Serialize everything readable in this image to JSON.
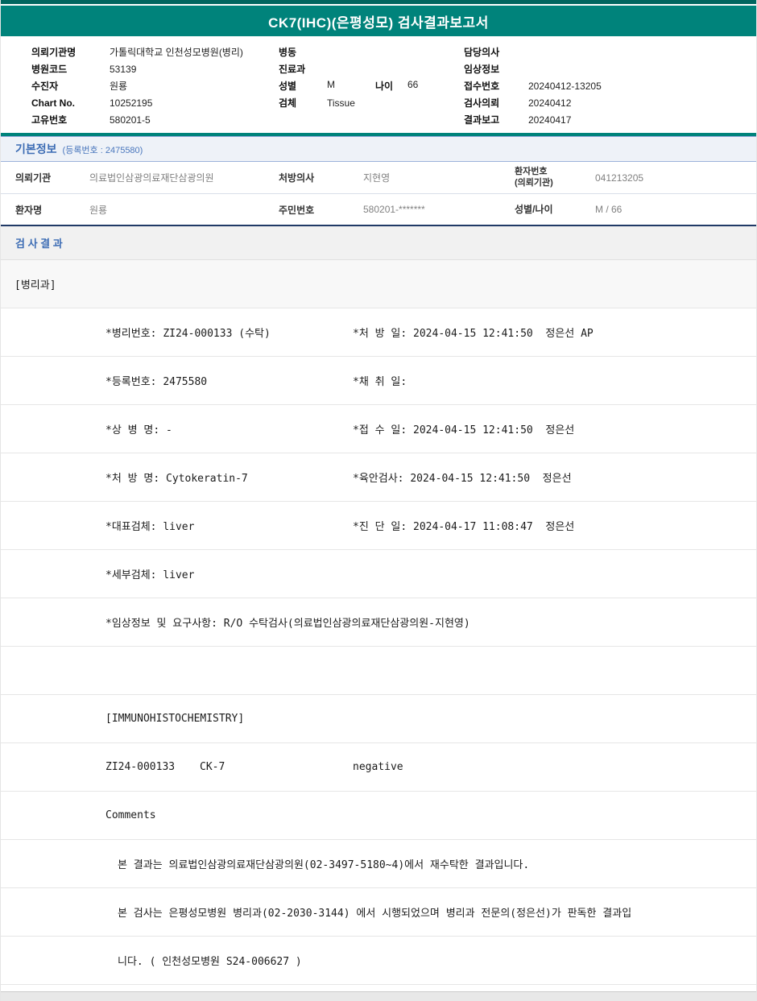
{
  "header": {
    "title": "CK7(IHC)(은평성모) 검사결과보고서"
  },
  "patient_info": {
    "rows": [
      {
        "l_label": "의뢰기관명",
        "l_value": "가톨릭대학교 인천성모병원(병리)",
        "m_label": "병동",
        "m_value": "",
        "r_label": "담당의사",
        "r_value": ""
      },
      {
        "l_label": "병원코드",
        "l_value": "53139",
        "m_label": "진료과",
        "m_value": "",
        "r_label": "임상정보",
        "r_value": ""
      },
      {
        "l_label": "수진자",
        "l_value": "원룡",
        "m_label": "성별",
        "m_value": "M",
        "m_label2": "나이",
        "m_value2": "66",
        "r_label": "접수번호",
        "r_value": "20240412-13205"
      },
      {
        "l_label": "Chart No.",
        "l_value": "10252195",
        "m_label": "검체",
        "m_value": "Tissue",
        "r_label": "검사의뢰",
        "r_value": "20240412"
      },
      {
        "l_label": "고유번호",
        "l_value": "580201-5",
        "m_label": "",
        "m_value": "",
        "r_label": "결과보고",
        "r_value": "20240417"
      }
    ]
  },
  "basic_info": {
    "title": "기본정보",
    "subtitle": "(등록번호 : 2475580)",
    "row1": {
      "c1": "의뢰기관",
      "c2": "의료법인삼광의료재단삼광의원",
      "c3": "처방의사",
      "c4": "지현영",
      "c5a": "환자번호",
      "c5b": "(의뢰기관)",
      "c6": "041213205"
    },
    "row2": {
      "c1": "환자명",
      "c2": "원룡",
      "c3": "주민번호",
      "c4": "580201-*******",
      "c5a": "성별/나이",
      "c5b": "",
      "c6": "M / 66"
    }
  },
  "results": {
    "title": "검 사 결 과",
    "department": "[병리과]",
    "detail_rows": [
      {
        "left": "*병리번호: ZI24-000133 (수탁)",
        "right": "*처 방 일: 2024-04-15 12:41:50  정은선 AP"
      },
      {
        "left": "*등록번호: 2475580",
        "right": "*채 취 일:"
      },
      {
        "left": "*상 병 명: -",
        "right": "*접 수 일: 2024-04-15 12:41:50  정은선"
      },
      {
        "left": "*처 방 명: Cytokeratin-7",
        "right": "*육안검사: 2024-04-15 12:41:50  정은선"
      },
      {
        "left": "*대표검체: liver",
        "right": "*진 단 일: 2024-04-17 11:08:47  정은선"
      },
      {
        "left": "*세부검체: liver",
        "right": ""
      }
    ],
    "clinical_info": "*임상정보 및 요구사항: R/O 수탁검사(의료법인삼광의료재단삼광의원-지현영)",
    "section_label": "[IMMUNOHISTOCHEMISTRY]",
    "result_line": {
      "specimen": "ZI24-000133",
      "test": "CK-7",
      "result": "negative"
    },
    "comments_label": "Comments",
    "comment_lines": [
      "본 결과는 의료법인삼광의료재단삼광의원(02-3497-5180~4)에서 재수탁한 결과입니다.",
      "본 검사는 은평성모병원 병리과(02-2030-3144) 에서 시행되었으며 병리과 전문의(정은선)가 판독한 결과입",
      "니다. ( 인천성모병원 S24-006627 )"
    ]
  },
  "colors": {
    "teal": "#00837b",
    "teal_dark": "#00665f",
    "blue_text": "#3c6cb4",
    "navy_border": "#203a66"
  }
}
